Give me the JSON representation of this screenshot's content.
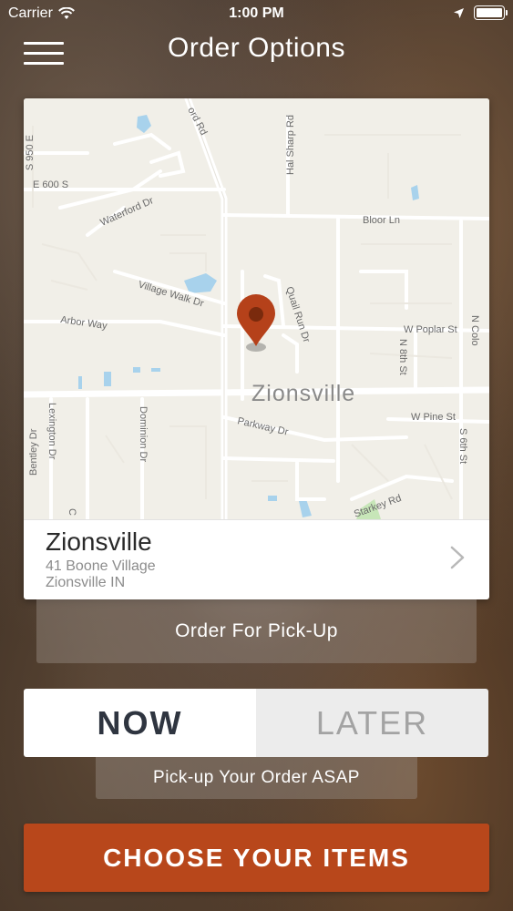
{
  "status_bar": {
    "carrier": "Carrier",
    "time": "1:00 PM"
  },
  "header": {
    "title": "Order Options"
  },
  "map": {
    "city_label": "Zionsville",
    "street_labels": {
      "s950e": "S 950 E",
      "ord_rd": "ord Rd",
      "hal_sharp_rd": "Hal Sharp Rd",
      "e600s": "E 600 S",
      "waterford_dr": "Waterford Dr",
      "bloor_ln": "Bloor Ln",
      "village_walk_dr": "Village Walk Dr",
      "quail_run_dr": "Quail Run Dr",
      "arbor_way": "Arbor Way",
      "w_poplar_st": "W Poplar St",
      "n8th_st": "N 8th St",
      "n_side_col": "N Colo",
      "w_pine_st": "W Pine St",
      "parkway_dr": "Parkway Dr",
      "bentley_dr": "Bentley Dr",
      "lexington_dr": "Lexington Dr",
      "dominion_dr": "Dominion Dr",
      "s6th_st": "S 6th St",
      "starkey_rd": "Starkey Rd",
      "c_fragment": "C"
    },
    "pin_color": "#b5411a"
  },
  "location": {
    "name": "Zionsville",
    "address_line1": "41 Boone Village",
    "address_line2": "Zionsville IN"
  },
  "order_type": {
    "label": "Order For Pick-Up"
  },
  "timing": {
    "now_label": "NOW",
    "later_label": "LATER",
    "selected": "NOW"
  },
  "pickup_message": "Pick-up Your Order ASAP",
  "cta": {
    "label": "CHOOSE YOUR ITEMS",
    "color": "#b8471b"
  }
}
